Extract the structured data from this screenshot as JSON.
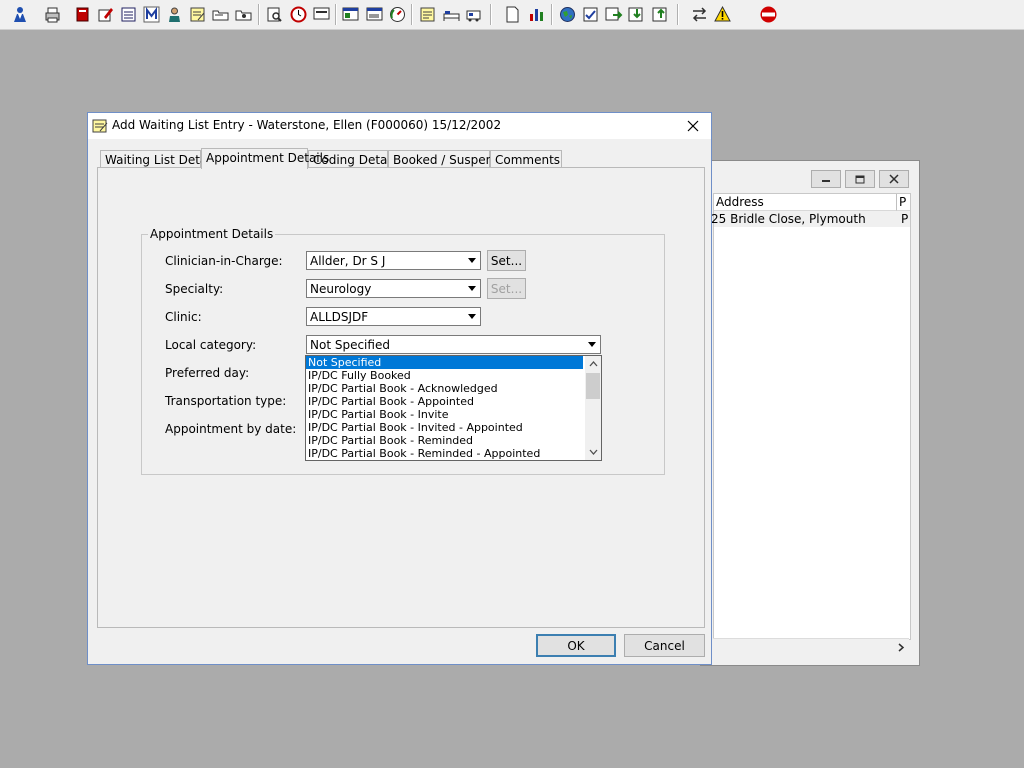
{
  "toolbar": {
    "icons": [
      "user-icon",
      "print-icon",
      "book-icon",
      "edit-book-icon",
      "list-icon",
      "m-icon",
      "person-icon",
      "notes-icon",
      "folder-icon",
      "folder2-icon",
      "search-doc-icon",
      "clock-icon",
      "screen-icon",
      "window-icon",
      "chart-window-icon",
      "gauge-icon",
      "notepad-icon",
      "bed-icon",
      "ambulance-icon",
      "document-icon",
      "bar-chart-icon",
      "globe-icon",
      "check-form-icon",
      "transfer-icon",
      "inbox-icon",
      "outbox-icon",
      "swap-icon",
      "warning-icon",
      "exit-icon"
    ]
  },
  "background_window": {
    "columns": [
      "Address",
      "P"
    ],
    "row": {
      "address": "25 Bridle Close, Plymouth",
      "p": "P"
    }
  },
  "dialog": {
    "title": "Add Waiting List Entry - Waterstone, Ellen (F000060) 15/12/2002",
    "tabs": [
      "Waiting List Details",
      "Appointment Details",
      "Coding Details",
      "Booked / Suspend",
      "Comments"
    ],
    "active_tab": "Appointment Details",
    "group_title": "Appointment Details",
    "fields": {
      "clinician_label": "Clinician-in-Charge:",
      "clinician_value": "Allder, Dr S J",
      "specialty_label": "Specialty:",
      "specialty_value": "Neurology",
      "clinic_label": "Clinic:",
      "clinic_value": "ALLDSJDF",
      "local_category_label": "Local category:",
      "local_category_value": "Not Specified",
      "preferred_day_label": "Preferred day:",
      "transport_label": "Transportation type:",
      "appt_by_date_label": "Appointment by date:"
    },
    "set_button": "Set...",
    "dropdown_options": [
      "Not Specified",
      "IP/DC Fully Booked",
      "IP/DC Partial Book - Acknowledged",
      "IP/DC Partial Book - Appointed",
      "IP/DC Partial Book - Invite",
      "IP/DC Partial Book - Invited - Appointed",
      "IP/DC Partial Book - Reminded",
      "IP/DC Partial Book - Reminded - Appointed"
    ],
    "ok_label": "OK",
    "cancel_label": "Cancel"
  }
}
